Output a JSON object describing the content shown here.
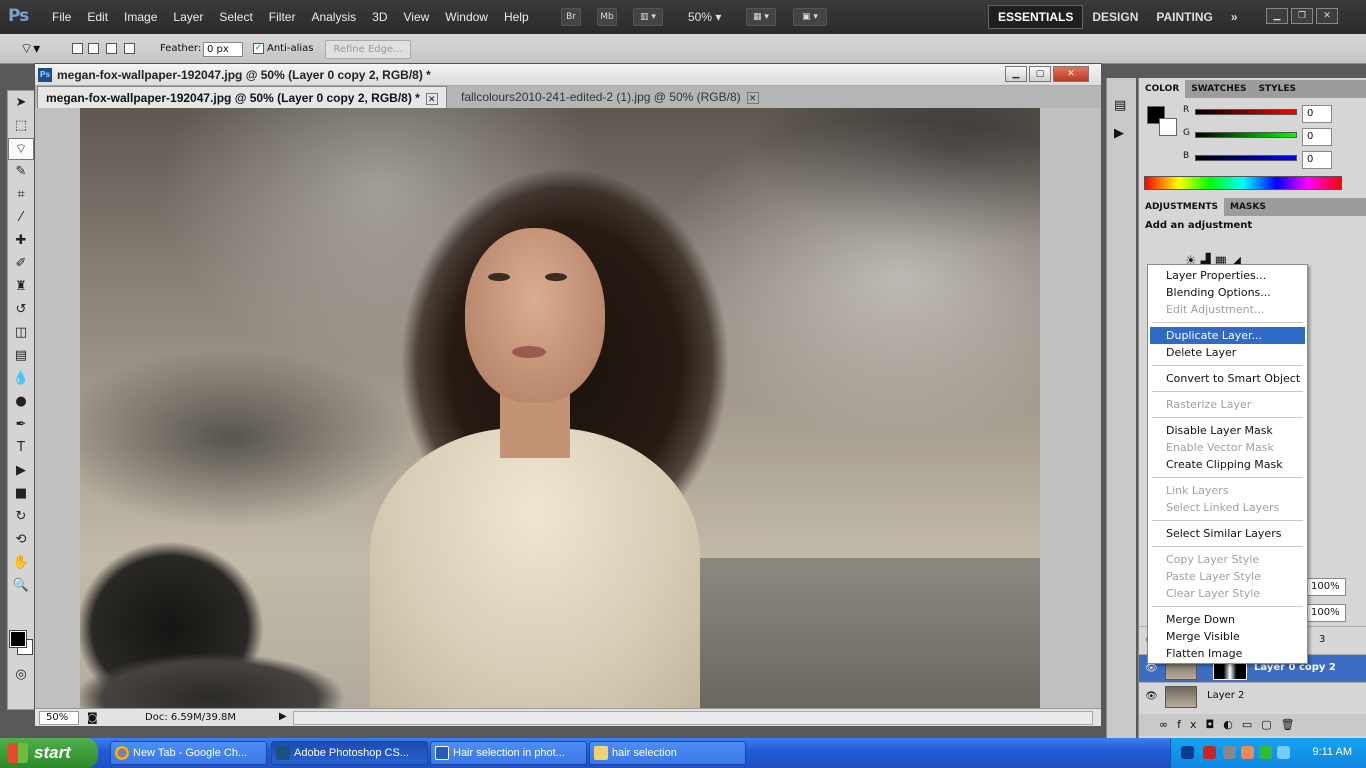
{
  "app": {
    "logo": "Ps",
    "menu": [
      "File",
      "Edit",
      "Image",
      "Layer",
      "Select",
      "Filter",
      "Analysis",
      "3D",
      "View",
      "Window",
      "Help"
    ],
    "bridge_label": "Br",
    "minibridge_label": "Mb",
    "zoom": "50%",
    "workspaces": [
      "ESSENTIALS",
      "DESIGN",
      "PAINTING"
    ],
    "more": "»"
  },
  "options": {
    "feather_label": "Feather:",
    "feather_value": "0 px",
    "antialias_label": "Anti-alias",
    "refine_edge": "Refine Edge..."
  },
  "document": {
    "window_title": "megan-fox-wallpaper-192047.jpg @ 50% (Layer 0 copy 2, RGB/8) *",
    "tabs": [
      {
        "label": "megan-fox-wallpaper-192047.jpg @ 50% (Layer 0 copy 2, RGB/8) *"
      },
      {
        "label": "fallcolours2010-241-edited-2 (1).jpg @ 50% (RGB/8)"
      }
    ],
    "zoom": "50%",
    "doc_info": "Doc: 6.59M/39.8M"
  },
  "color_panel": {
    "tabs": [
      "COLOR",
      "SWATCHES",
      "STYLES"
    ],
    "channels": [
      {
        "label": "R",
        "value": "0"
      },
      {
        "label": "G",
        "value": "0"
      },
      {
        "label": "B",
        "value": "0"
      }
    ]
  },
  "adjustments_panel": {
    "tabs": [
      "ADJUSTMENTS",
      "MASKS"
    ],
    "title": "Add an adjustment"
  },
  "layers": {
    "opacity": "100%",
    "fill": "100%",
    "rows": [
      {
        "name": "3"
      },
      {
        "name": "Layer 0 copy 2"
      },
      {
        "name": "Layer 2"
      }
    ]
  },
  "context_menu": {
    "items": [
      {
        "label": "Layer Properties...",
        "enabled": true
      },
      {
        "label": "Blending Options...",
        "enabled": true
      },
      {
        "label": "Edit Adjustment...",
        "enabled": false
      },
      {
        "label": "Duplicate Layer...",
        "enabled": true,
        "highlighted": true
      },
      {
        "label": "Delete Layer",
        "enabled": true
      },
      {
        "label": "Convert to Smart Object",
        "enabled": true
      },
      {
        "label": "Rasterize Layer",
        "enabled": false
      },
      {
        "label": "Disable Layer Mask",
        "enabled": true
      },
      {
        "label": "Enable Vector Mask",
        "enabled": false
      },
      {
        "label": "Create Clipping Mask",
        "enabled": true
      },
      {
        "label": "Link Layers",
        "enabled": false
      },
      {
        "label": "Select Linked Layers",
        "enabled": false
      },
      {
        "label": "Select Similar Layers",
        "enabled": true
      },
      {
        "label": "Copy Layer Style",
        "enabled": false
      },
      {
        "label": "Paste Layer Style",
        "enabled": false
      },
      {
        "label": "Clear Layer Style",
        "enabled": false
      },
      {
        "label": "Merge Down",
        "enabled": true
      },
      {
        "label": "Merge Visible",
        "enabled": true
      },
      {
        "label": "Flatten Image",
        "enabled": true
      }
    ]
  },
  "taskbar": {
    "start": "start",
    "tasks": [
      {
        "label": "New Tab - Google Ch..."
      },
      {
        "label": "Adobe Photoshop CS..."
      },
      {
        "label": "Hair selection in phot..."
      },
      {
        "label": "hair selection"
      }
    ],
    "clock": "9:11 AM"
  }
}
